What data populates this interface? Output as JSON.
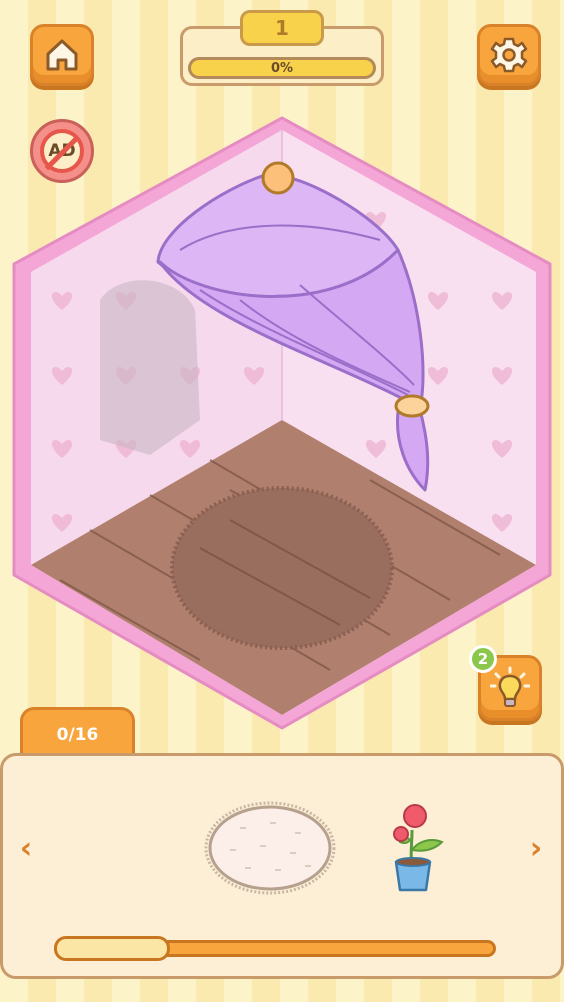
{
  "hud": {
    "level": "1",
    "progress_text": "0%",
    "progress_fraction": 0.0
  },
  "icons": {
    "home": "home-icon",
    "settings": "gear-icon",
    "no_ads": "no-ads-icon",
    "hint": "lightbulb-icon",
    "prev": "chevron-left-icon",
    "next": "chevron-right-icon"
  },
  "ad_button": {
    "label": "AD"
  },
  "hint": {
    "count": "2"
  },
  "tray": {
    "counter": "0/16",
    "items": [
      {
        "name": "round-rug"
      },
      {
        "name": "potted-rose"
      }
    ],
    "prev_arrow": "‹",
    "next_arrow": "›",
    "scroll_fraction": 0.26
  },
  "colors": {
    "accent": "#f9a53d",
    "room_border": "#f4a6d6",
    "wall": "#f7dcee",
    "floor": "#b07f6d",
    "canopy": "#dcb6f5"
  }
}
